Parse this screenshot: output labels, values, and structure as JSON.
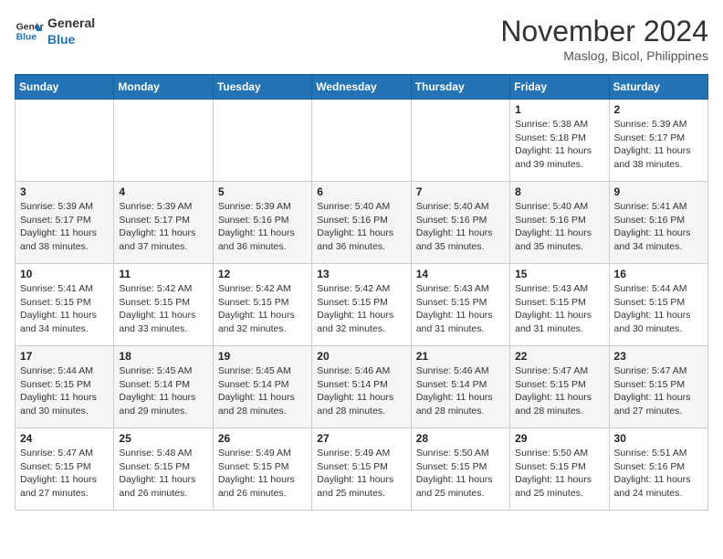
{
  "header": {
    "logo_line1": "General",
    "logo_line2": "Blue",
    "month_title": "November 2024",
    "location": "Maslog, Bicol, Philippines"
  },
  "weekdays": [
    "Sunday",
    "Monday",
    "Tuesday",
    "Wednesday",
    "Thursday",
    "Friday",
    "Saturday"
  ],
  "weeks": [
    [
      {
        "day": "",
        "info": ""
      },
      {
        "day": "",
        "info": ""
      },
      {
        "day": "",
        "info": ""
      },
      {
        "day": "",
        "info": ""
      },
      {
        "day": "",
        "info": ""
      },
      {
        "day": "1",
        "info": "Sunrise: 5:38 AM\nSunset: 5:18 PM\nDaylight: 11 hours\nand 39 minutes."
      },
      {
        "day": "2",
        "info": "Sunrise: 5:39 AM\nSunset: 5:17 PM\nDaylight: 11 hours\nand 38 minutes."
      }
    ],
    [
      {
        "day": "3",
        "info": "Sunrise: 5:39 AM\nSunset: 5:17 PM\nDaylight: 11 hours\nand 38 minutes."
      },
      {
        "day": "4",
        "info": "Sunrise: 5:39 AM\nSunset: 5:17 PM\nDaylight: 11 hours\nand 37 minutes."
      },
      {
        "day": "5",
        "info": "Sunrise: 5:39 AM\nSunset: 5:16 PM\nDaylight: 11 hours\nand 36 minutes."
      },
      {
        "day": "6",
        "info": "Sunrise: 5:40 AM\nSunset: 5:16 PM\nDaylight: 11 hours\nand 36 minutes."
      },
      {
        "day": "7",
        "info": "Sunrise: 5:40 AM\nSunset: 5:16 PM\nDaylight: 11 hours\nand 35 minutes."
      },
      {
        "day": "8",
        "info": "Sunrise: 5:40 AM\nSunset: 5:16 PM\nDaylight: 11 hours\nand 35 minutes."
      },
      {
        "day": "9",
        "info": "Sunrise: 5:41 AM\nSunset: 5:16 PM\nDaylight: 11 hours\nand 34 minutes."
      }
    ],
    [
      {
        "day": "10",
        "info": "Sunrise: 5:41 AM\nSunset: 5:15 PM\nDaylight: 11 hours\nand 34 minutes."
      },
      {
        "day": "11",
        "info": "Sunrise: 5:42 AM\nSunset: 5:15 PM\nDaylight: 11 hours\nand 33 minutes."
      },
      {
        "day": "12",
        "info": "Sunrise: 5:42 AM\nSunset: 5:15 PM\nDaylight: 11 hours\nand 32 minutes."
      },
      {
        "day": "13",
        "info": "Sunrise: 5:42 AM\nSunset: 5:15 PM\nDaylight: 11 hours\nand 32 minutes."
      },
      {
        "day": "14",
        "info": "Sunrise: 5:43 AM\nSunset: 5:15 PM\nDaylight: 11 hours\nand 31 minutes."
      },
      {
        "day": "15",
        "info": "Sunrise: 5:43 AM\nSunset: 5:15 PM\nDaylight: 11 hours\nand 31 minutes."
      },
      {
        "day": "16",
        "info": "Sunrise: 5:44 AM\nSunset: 5:15 PM\nDaylight: 11 hours\nand 30 minutes."
      }
    ],
    [
      {
        "day": "17",
        "info": "Sunrise: 5:44 AM\nSunset: 5:15 PM\nDaylight: 11 hours\nand 30 minutes."
      },
      {
        "day": "18",
        "info": "Sunrise: 5:45 AM\nSunset: 5:14 PM\nDaylight: 11 hours\nand 29 minutes."
      },
      {
        "day": "19",
        "info": "Sunrise: 5:45 AM\nSunset: 5:14 PM\nDaylight: 11 hours\nand 28 minutes."
      },
      {
        "day": "20",
        "info": "Sunrise: 5:46 AM\nSunset: 5:14 PM\nDaylight: 11 hours\nand 28 minutes."
      },
      {
        "day": "21",
        "info": "Sunrise: 5:46 AM\nSunset: 5:14 PM\nDaylight: 11 hours\nand 28 minutes."
      },
      {
        "day": "22",
        "info": "Sunrise: 5:47 AM\nSunset: 5:15 PM\nDaylight: 11 hours\nand 28 minutes."
      },
      {
        "day": "23",
        "info": "Sunrise: 5:47 AM\nSunset: 5:15 PM\nDaylight: 11 hours\nand 27 minutes."
      }
    ],
    [
      {
        "day": "24",
        "info": "Sunrise: 5:47 AM\nSunset: 5:15 PM\nDaylight: 11 hours\nand 27 minutes."
      },
      {
        "day": "25",
        "info": "Sunrise: 5:48 AM\nSunset: 5:15 PM\nDaylight: 11 hours\nand 26 minutes."
      },
      {
        "day": "26",
        "info": "Sunrise: 5:49 AM\nSunset: 5:15 PM\nDaylight: 11 hours\nand 26 minutes."
      },
      {
        "day": "27",
        "info": "Sunrise: 5:49 AM\nSunset: 5:15 PM\nDaylight: 11 hours\nand 25 minutes."
      },
      {
        "day": "28",
        "info": "Sunrise: 5:50 AM\nSunset: 5:15 PM\nDaylight: 11 hours\nand 25 minutes."
      },
      {
        "day": "29",
        "info": "Sunrise: 5:50 AM\nSunset: 5:15 PM\nDaylight: 11 hours\nand 25 minutes."
      },
      {
        "day": "30",
        "info": "Sunrise: 5:51 AM\nSunset: 5:16 PM\nDaylight: 11 hours\nand 24 minutes."
      }
    ]
  ]
}
